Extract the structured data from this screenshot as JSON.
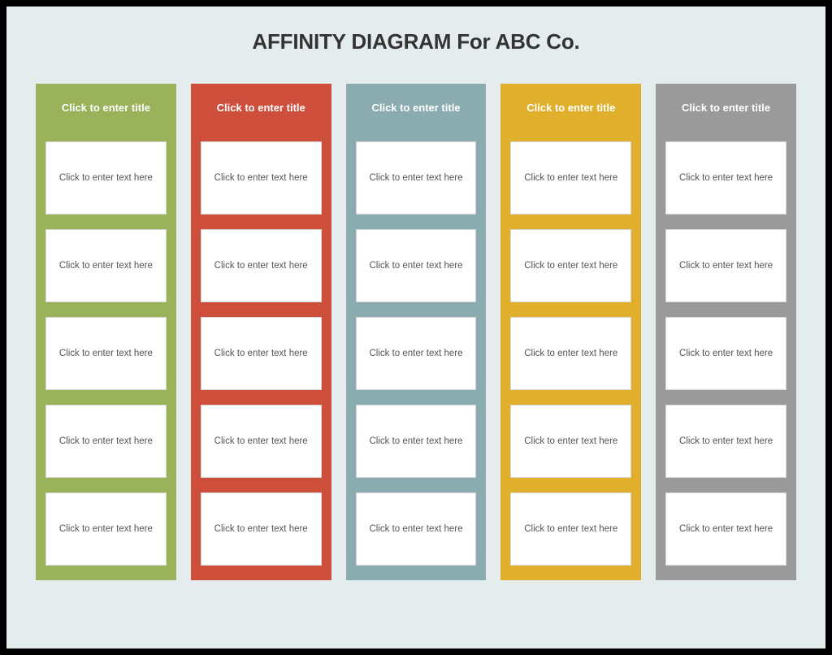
{
  "title": "AFFINITY DIAGRAM For ABC Co.",
  "columns": [
    {
      "color": "#9ab25a",
      "title": "Click to enter title",
      "cards": [
        "Click to enter text here",
        "Click to enter text here",
        "Click to enter text here",
        "Click to enter text here",
        "Click to enter text here"
      ]
    },
    {
      "color": "#ce4e3c",
      "title": "Click to enter title",
      "cards": [
        "Click to enter text here",
        "Click to enter text here",
        "Click to enter text here",
        "Click to enter text here",
        "Click to enter text here"
      ]
    },
    {
      "color": "#8aacb0",
      "title": "Click to enter title",
      "cards": [
        "Click to enter text here",
        "Click to enter text here",
        "Click to enter text here",
        "Click to enter text here",
        "Click to enter text here"
      ]
    },
    {
      "color": "#e0b02c",
      "title": "Click to enter title",
      "cards": [
        "Click to enter text here",
        "Click to enter text here",
        "Click to enter text here",
        "Click to enter text here",
        "Click to enter text here"
      ]
    },
    {
      "color": "#9a9a9a",
      "title": "Click to enter title",
      "cards": [
        "Click to enter text here",
        "Click to enter text here",
        "Click to enter text here",
        "Click to enter text here",
        "Click to enter text here"
      ]
    }
  ]
}
